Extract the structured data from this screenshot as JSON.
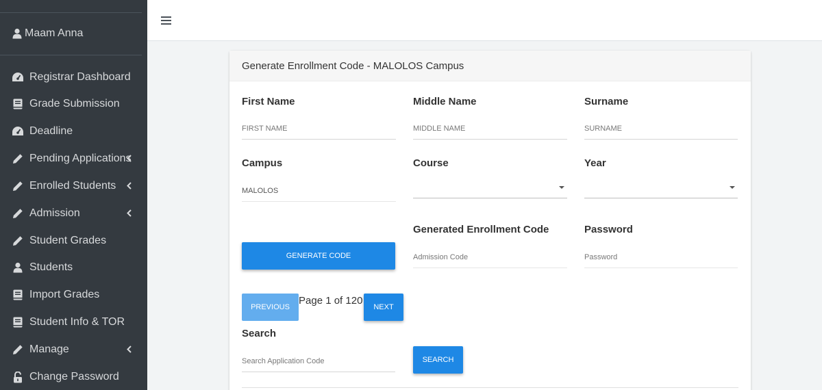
{
  "sidebar": {
    "user_name": "Maam Anna",
    "items": [
      {
        "label": "Registrar Dashboard",
        "icon": "tachometer-icon"
      },
      {
        "label": "Grade Submission",
        "icon": "book-icon"
      },
      {
        "label": "Deadline",
        "icon": "tachometer-icon"
      },
      {
        "label": "Pending Applications",
        "icon": "pencil-icon"
      },
      {
        "label": "Enrolled Students",
        "icon": "pencil-icon"
      },
      {
        "label": "Admission",
        "icon": "pencil-icon"
      },
      {
        "label": "Student Grades",
        "icon": "pencil-icon"
      },
      {
        "label": "Students",
        "icon": "user-icon"
      },
      {
        "label": "Import Grades",
        "icon": "book-icon"
      },
      {
        "label": "Student Info & TOR",
        "icon": "book-icon"
      },
      {
        "label": "Manage",
        "icon": "pencil-icon"
      },
      {
        "label": "Change Password",
        "icon": "unlock-icon"
      }
    ]
  },
  "card": {
    "title": "Generate Enrollment Code - MALOLOS Campus"
  },
  "form": {
    "first_name_label": "First Name",
    "first_name_placeholder": "FIRST NAME",
    "middle_name_label": "Middle Name",
    "middle_name_placeholder": "MIDDLE NAME",
    "surname_label": "Surname",
    "surname_placeholder": "SURNAME",
    "campus_label": "Campus",
    "campus_value": "MALOLOS",
    "course_label": "Course",
    "course_value": "",
    "year_label": "Year",
    "year_value": "",
    "generated_code_label": "Generated Enrollment Code",
    "generated_code_placeholder": "Admission Code",
    "password_label": "Password",
    "password_placeholder": "Password",
    "generate_button": "GENERATE CODE"
  },
  "pagination": {
    "previous_label": "PREVIOUS",
    "page_text": "Page 1 of 120",
    "next_label": "NEXT"
  },
  "search": {
    "label": "Search",
    "placeholder": "Search Application Code",
    "button_label": "SEARCH"
  },
  "colors": {
    "sidebar_bg": "#343a40",
    "primary": "#1e88e5"
  }
}
